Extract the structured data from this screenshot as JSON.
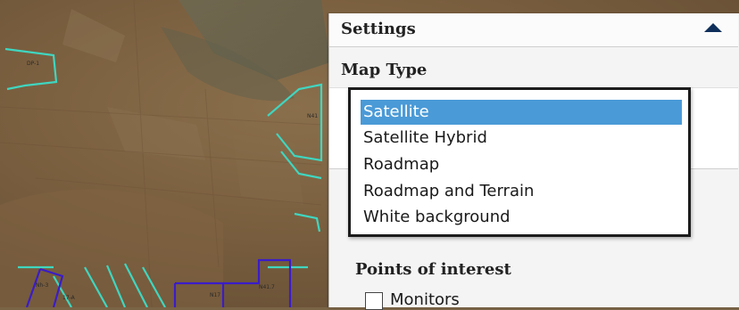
{
  "map": {
    "background": "satellite",
    "parcel_outline_color": "#3fd6c0",
    "poi_outline_color": "#3a1cc8",
    "parcel_labels": [
      "DP-1",
      "N41",
      "N17",
      "N41.7",
      "Nh-3",
      "17-A"
    ]
  },
  "settings": {
    "title": "Settings",
    "collapse_icon": "triangle-up-icon",
    "map_type_label": "Map Type",
    "map_type_options": [
      "Satellite",
      "Satellite Hybrid",
      "Roadmap",
      "Roadmap and Terrain",
      "White background"
    ],
    "selected_map_type": "Satellite",
    "points_of_interest_label": "Points of interest",
    "poi_items": [
      {
        "label": "Monitors",
        "checked": false
      }
    ]
  },
  "colors": {
    "selected_option_bg": "#4a9ad7",
    "header_icon": "#0f2f5a"
  }
}
